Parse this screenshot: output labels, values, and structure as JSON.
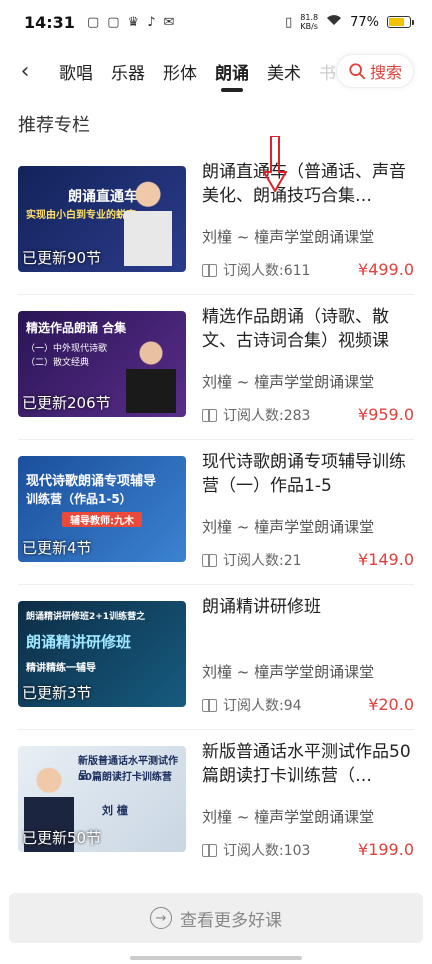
{
  "status": {
    "time": "14:31",
    "net_speed_value": "81.8",
    "net_speed_unit": "KB/s",
    "battery": "77%"
  },
  "tabs": [
    "歌唱",
    "乐器",
    "形体",
    "朗诵",
    "美术",
    "书"
  ],
  "active_tab_index": 3,
  "search_label": "搜索",
  "section_title": "推荐专栏",
  "courses": [
    {
      "title": "朗诵直通车（普通话、声音美化、朗诵技巧合集…",
      "author": "刘橦 ~ 橦声学堂朗诵课堂",
      "subscribers": "订阅人数:611",
      "price": "¥499.0",
      "updated": "已更新90节",
      "thumb_line1": "朗诵直通车",
      "thumb_line2": "实现由小白到专业的蜕变",
      "thumb_line3": "",
      "bg": "#1c2a66"
    },
    {
      "title": "精选作品朗诵（诗歌、散文、古诗词合集）视频课",
      "author": "刘橦 ~ 橦声学堂朗诵课堂",
      "subscribers": "订阅人数:283",
      "price": "¥959.0",
      "updated": "已更新206节",
      "thumb_line1": "精选作品朗诵 合集",
      "thumb_line2": "（一）中外现代诗歌",
      "thumb_line3": "（二）散文经典",
      "bg": "#3a1f6b"
    },
    {
      "title": "现代诗歌朗诵专项辅导训练营（一）作品1-5",
      "author": "刘橦 ~ 橦声学堂朗诵课堂",
      "subscribers": "订阅人数:21",
      "price": "¥149.0",
      "updated": "已更新4节",
      "thumb_line1": "现代诗歌朗诵专项辅导",
      "thumb_line2": "训练营（作品1-5）",
      "thumb_line3": "辅导教师:九木",
      "bg": "#1e5aa8"
    },
    {
      "title": "朗诵精讲研修班",
      "author": "刘橦 ~ 橦声学堂朗诵课堂",
      "subscribers": "订阅人数:94",
      "price": "¥20.0",
      "updated": "已更新3节",
      "thumb_line1": "朗诵精讲研修班2+1训练营之",
      "thumb_line2": "朗诵精讲研修班",
      "thumb_line3": "精讲精练一辅导",
      "bg": "#0f3b57"
    },
    {
      "title": "新版普通话水平测试作品50篇朗读打卡训练营（…",
      "author": "刘橦 ~ 橦声学堂朗诵课堂",
      "subscribers": "订阅人数:103",
      "price": "¥199.0",
      "updated": "已更新50节",
      "thumb_line1": "新版普通话水平测试作品",
      "thumb_line2": "50篇朗读打卡训练营",
      "thumb_line3": "刘 橦",
      "bg": "#dfe6ee"
    }
  ],
  "more_button": "查看更多好课"
}
